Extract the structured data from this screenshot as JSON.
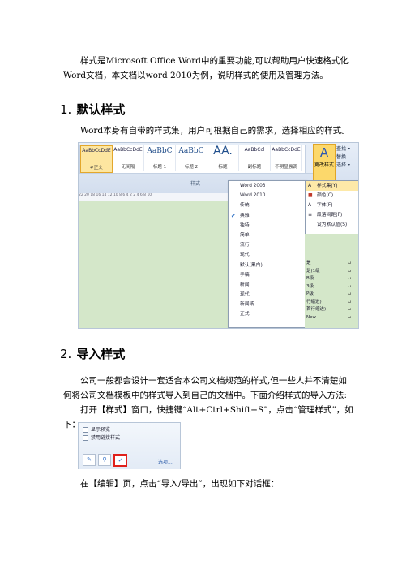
{
  "intro": "样式是Microsoft Office Word中的重要功能,可以帮助用户快速格式化Word文档，本文档以word 2010为例，说明样式的使用及管理方法。",
  "section1": {
    "num": "1.",
    "title": "默认样式",
    "body": "Word本身有自带的样式集，用户可根据自己的需求，选择相应的样式。"
  },
  "screenshot1": {
    "styles": [
      {
        "preview": "AaBbCcDdE",
        "name": "↵正文"
      },
      {
        "preview": "AaBbCcDdE",
        "name": "无间隔"
      },
      {
        "preview": "AaBbC",
        "name": "标题 1"
      },
      {
        "preview": "AaBbC",
        "name": "标题 2"
      },
      {
        "preview": "AA.",
        "name": "标题"
      },
      {
        "preview": "AaBbCcl",
        "name": "副标题"
      },
      {
        "preview": "AaBbCcDdE",
        "name": "不明显强调"
      }
    ],
    "group_label": "样式",
    "change_styles_label": "更改样式",
    "edit_items": [
      "查找 ▾",
      "替换",
      "选择 ▾"
    ],
    "ruler": "22 20 18 16 14 12 10 8 6 4 2 2 4 6 8 10",
    "menu_items": [
      "Word 2003",
      "Word 2010",
      "传统",
      "典雅",
      "独特",
      "简单",
      "流行",
      "现代",
      "默认(黑白)",
      "手稿",
      "新闻",
      "现代",
      "新闻纸",
      "正式"
    ],
    "checked_index": 3,
    "submenu": [
      {
        "icon": "A",
        "label": "样式集(Y)"
      },
      {
        "icon": "■",
        "label": "颜色(C)"
      },
      {
        "icon": "A",
        "label": "字体(F)"
      },
      {
        "icon": "≡",
        "label": "段落间距(P)"
      },
      {
        "icon": "",
        "label": "设为默认值(S)"
      }
    ],
    "style_list": [
      "是",
      "是(1级",
      "B级",
      "3级",
      "P级",
      "行缩进)",
      "首行缩进)",
      "New"
    ],
    "return_mark": "↵"
  },
  "section2": {
    "num": "2.",
    "title": "导入样式",
    "body1": "公司一般都会设计一套适合本公司文档规范的样式,但一些人并不清楚如何将公司文档模板中的样式导入到自己的文档中。下面介绍样式的导入方法:",
    "body2": "打开【样式】窗口，快捷键“Alt+Ctrl+Shift+S”，点击“管理样式”，如下：",
    "body3": "在【编辑】页，点击“导入/导出”，出现如下对话框："
  },
  "screenshot2": {
    "cb1": "显示预览",
    "cb2": "禁用链接样式",
    "options": "选项..."
  }
}
